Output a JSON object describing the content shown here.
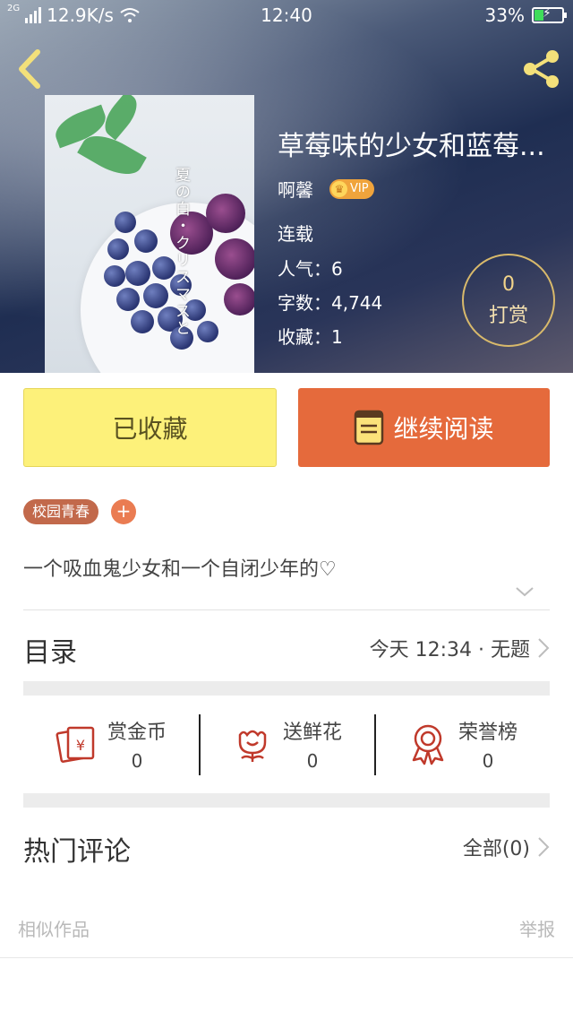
{
  "status_bar": {
    "network": "2G",
    "speed": "12.9K/s",
    "time": "12:40",
    "battery": "33%",
    "battery_level": 0.33
  },
  "book": {
    "title": "草莓味的少女和蓝莓...",
    "author": "啊馨",
    "vip_label": "VIP",
    "status": "连载",
    "popularity": "人气：6",
    "word_count": "字数：4,744",
    "favorites": "收藏：1",
    "cover_text": "夏の白・クリスマスと"
  },
  "reward": {
    "count": "0",
    "label": "打赏"
  },
  "actions": {
    "favorite_label": "已收藏",
    "read_label": "继续阅读"
  },
  "tags": [
    {
      "label": "校园青春"
    }
  ],
  "tag_add_label": "+",
  "description": "一个吸血鬼少女和一个自闭少年的♡",
  "toc": {
    "title": "目录",
    "latest": "今天 12:34 · 无题"
  },
  "stats": [
    {
      "label": "赏金币",
      "value": "0",
      "icon": "coin-envelope-icon"
    },
    {
      "label": "送鲜花",
      "value": "0",
      "icon": "flower-icon"
    },
    {
      "label": "荣誉榜",
      "value": "0",
      "icon": "medal-icon"
    }
  ],
  "comments": {
    "title": "热门评论",
    "all_label": "全部(0)"
  },
  "footer": {
    "similar": "相似作品",
    "report": "举报"
  },
  "colors": {
    "accent_orange": "#e56a3c",
    "fav_yellow": "#fdf17a",
    "tag_brown": "#c2694b",
    "icon_red": "#c0392b"
  }
}
